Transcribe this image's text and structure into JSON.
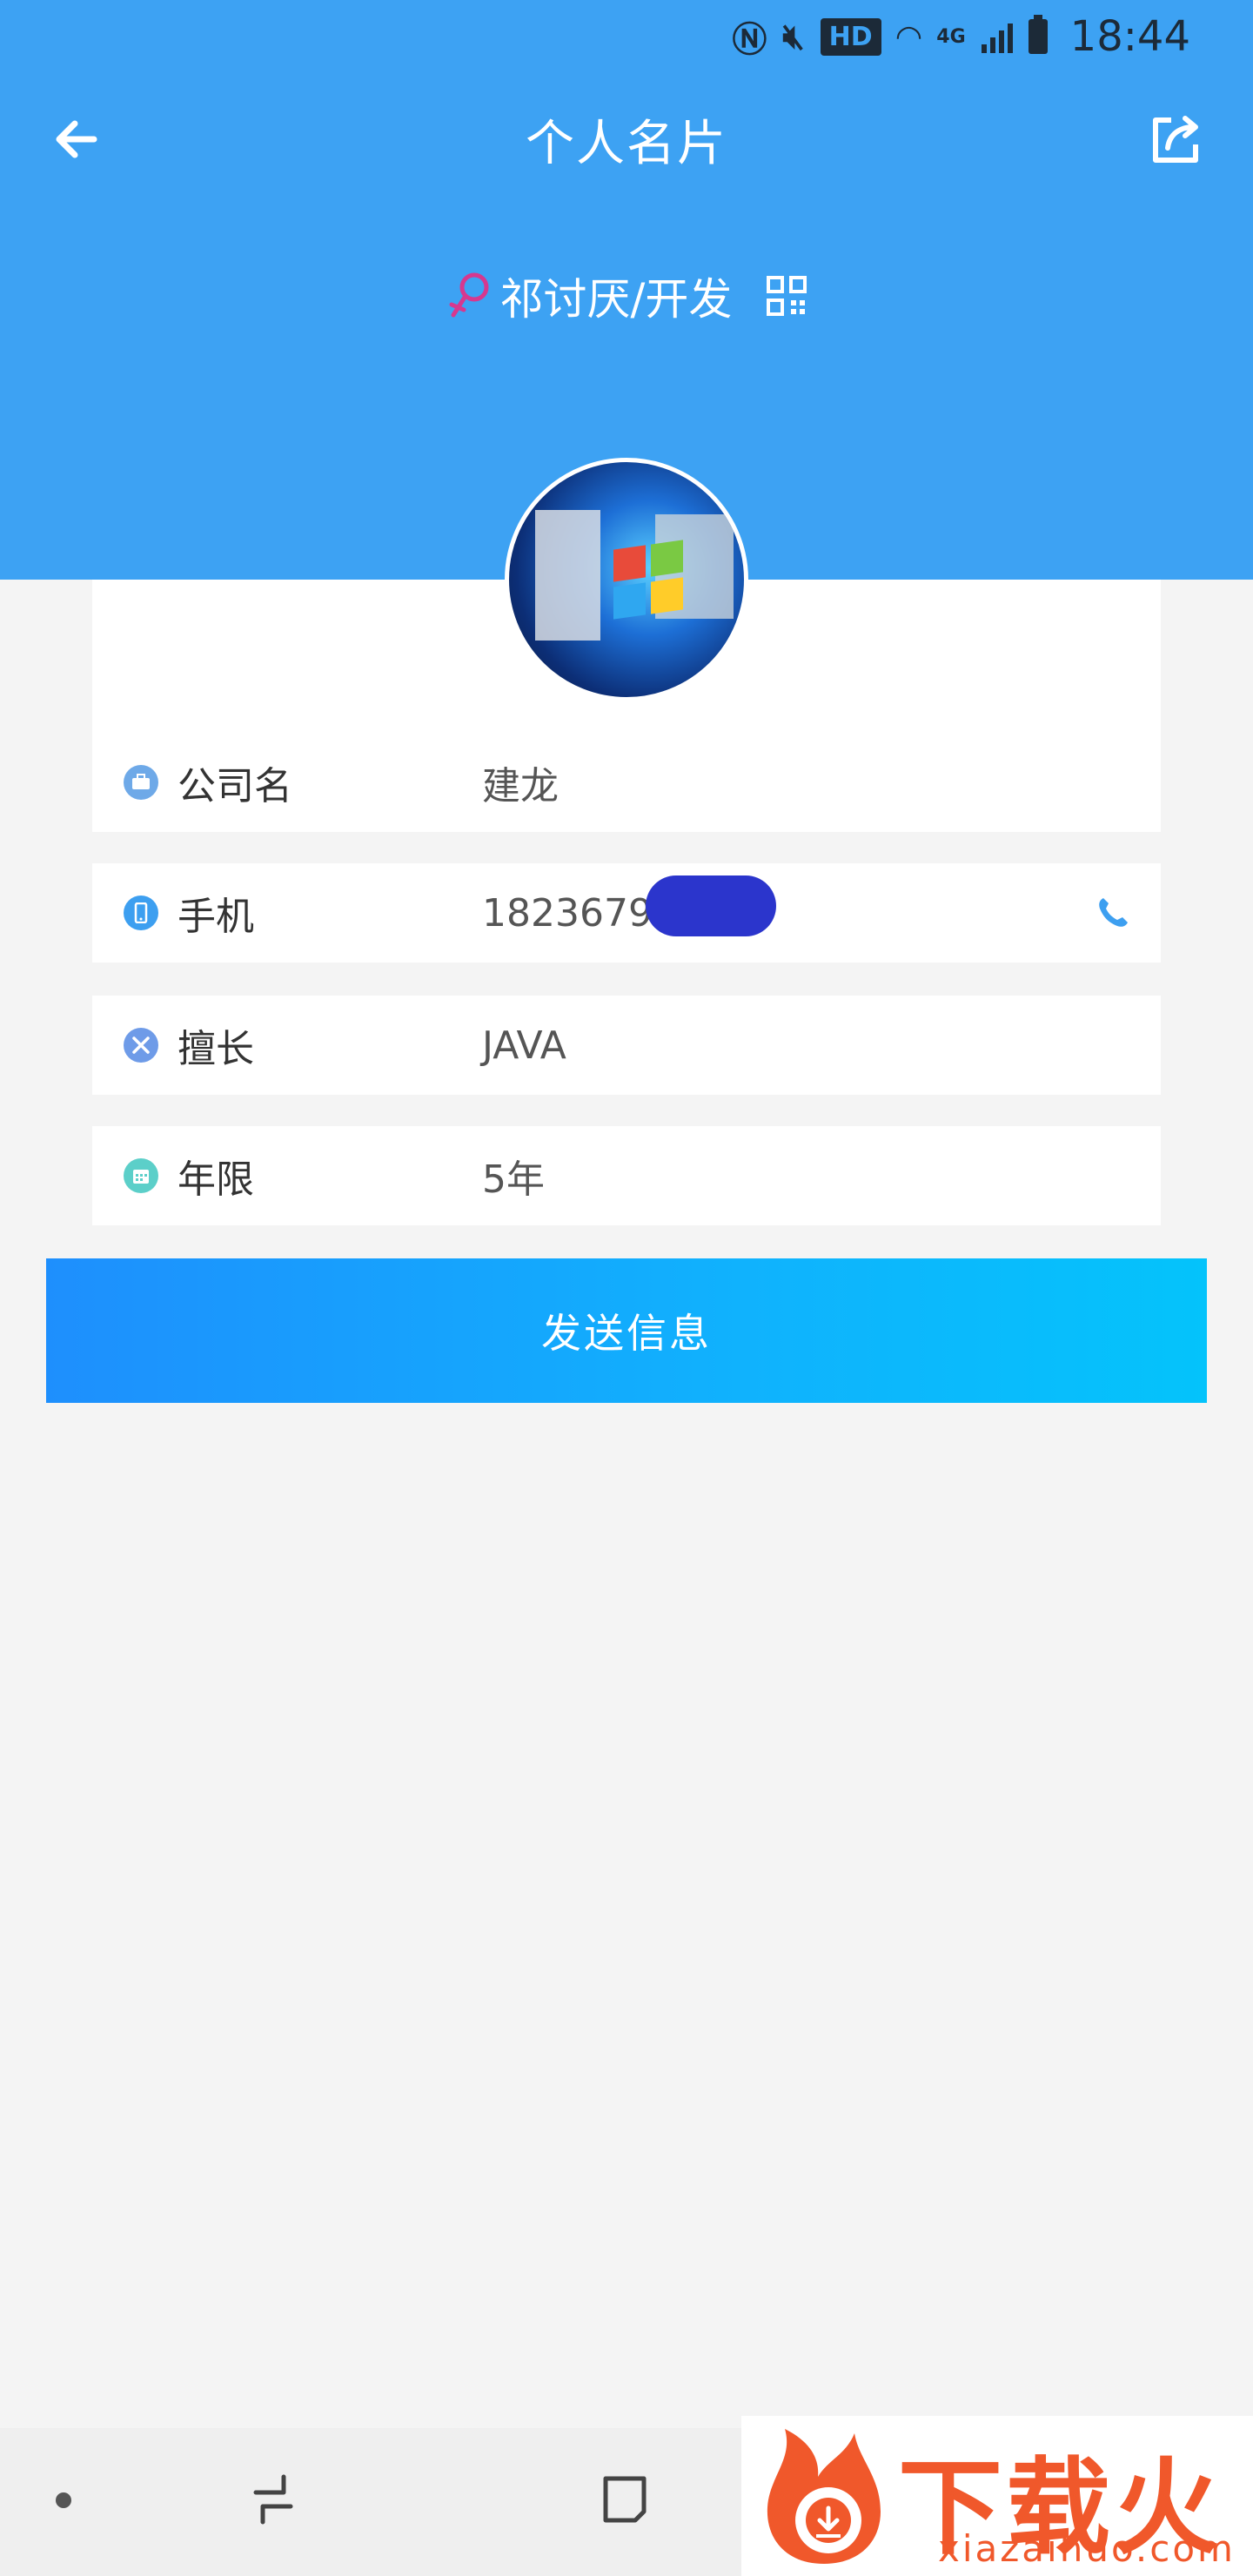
{
  "status_bar": {
    "network": "4G",
    "hd_badge": "HD",
    "time": "18:44"
  },
  "nav": {
    "title": "个人名片",
    "back_icon": "arrow-left-icon",
    "share_icon": "share-icon"
  },
  "profile": {
    "name_role": "祁讨厌/开发",
    "gender_icon": "female-icon",
    "qr_icon": "qr-code-icon"
  },
  "fields": [
    {
      "label": "公司名",
      "value": "建龙",
      "icon": "briefcase-icon",
      "color": "#6ea9e8"
    },
    {
      "label": "手机",
      "value": "1823679",
      "icon": "phone-icon",
      "color": "#3d9ff0"
    },
    {
      "label": "擅长",
      "value": "JAVA",
      "icon": "tools-icon",
      "color": "#6e9be8"
    },
    {
      "label": "年限",
      "value": "5年",
      "icon": "calendar-icon",
      "color": "#5ccfc9"
    }
  ],
  "send_button": "发送信息",
  "watermark": {
    "title": "下载火",
    "url": "xiazaihuo.com"
  },
  "colors": {
    "header": "#3da2f3",
    "background": "#f4f4f4",
    "button_start": "#1e8ffd",
    "button_end": "#04c3fb"
  }
}
